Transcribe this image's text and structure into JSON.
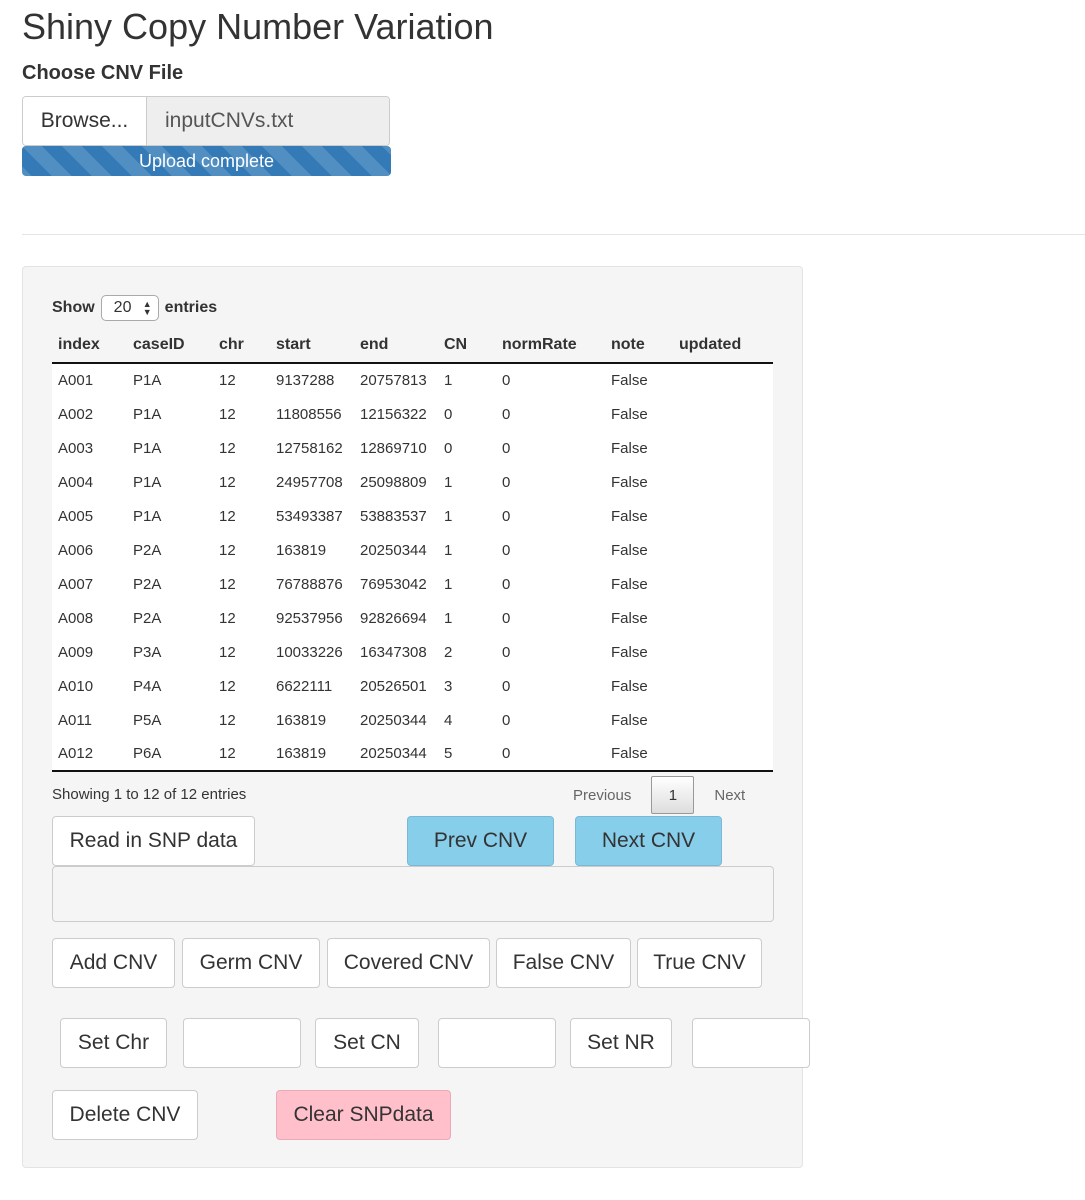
{
  "app": {
    "title": "Shiny Copy Number Variation"
  },
  "file_upload": {
    "label": "Choose CNV File",
    "browse_label": "Browse...",
    "file_name": "inputCNVs.txt",
    "progress_text": "Upload complete",
    "progress_fraction": 1.0,
    "progress_color": "#337ab7"
  },
  "table": {
    "show_label": "Show",
    "page_length": "20",
    "entries_label": "entries",
    "columns": [
      "index",
      "caseID",
      "chr",
      "start",
      "end",
      "CN",
      "normRate",
      "note",
      "updated"
    ],
    "rows": [
      [
        "A001",
        "P1A",
        "12",
        "9137288",
        "20757813",
        "1",
        "0",
        "False",
        ""
      ],
      [
        "A002",
        "P1A",
        "12",
        "11808556",
        "12156322",
        "0",
        "0",
        "False",
        ""
      ],
      [
        "A003",
        "P1A",
        "12",
        "12758162",
        "12869710",
        "0",
        "0",
        "False",
        ""
      ],
      [
        "A004",
        "P1A",
        "12",
        "24957708",
        "25098809",
        "1",
        "0",
        "False",
        ""
      ],
      [
        "A005",
        "P1A",
        "12",
        "53493387",
        "53883537",
        "1",
        "0",
        "False",
        ""
      ],
      [
        "A006",
        "P2A",
        "12",
        "163819",
        "20250344",
        "1",
        "0",
        "False",
        ""
      ],
      [
        "A007",
        "P2A",
        "12",
        "76788876",
        "76953042",
        "1",
        "0",
        "False",
        ""
      ],
      [
        "A008",
        "P2A",
        "12",
        "92537956",
        "92826694",
        "1",
        "0",
        "False",
        ""
      ],
      [
        "A009",
        "P3A",
        "12",
        "10033226",
        "16347308",
        "2",
        "0",
        "False",
        ""
      ],
      [
        "A010",
        "P4A",
        "12",
        "6622111",
        "20526501",
        "3",
        "0",
        "False",
        ""
      ],
      [
        "A011",
        "P5A",
        "12",
        "163819",
        "20250344",
        "4",
        "0",
        "False",
        ""
      ],
      [
        "A012",
        "P6A",
        "12",
        "163819",
        "20250344",
        "5",
        "0",
        "False",
        ""
      ]
    ],
    "info": "Showing 1 to 12 of 12 entries",
    "pager": {
      "previous": "Previous",
      "page": "1",
      "next": "Next"
    }
  },
  "buttons": {
    "read_snp": "Read in SNP data",
    "prev_cnv": "Prev CNV",
    "next_cnv": "Next CNV",
    "add_cnv": "Add CNV",
    "germ_cnv": "Germ CNV",
    "covered_cnv": "Covered CNV",
    "false_cnv": "False CNV",
    "true_cnv": "True CNV",
    "set_chr": "Set Chr",
    "set_cn": "Set CN",
    "set_nr": "Set NR",
    "delete_cnv": "Delete CNV",
    "clear_snpdata": "Clear SNPdata"
  },
  "inputs": {
    "chr_value": "",
    "cn_value": "",
    "nr_value": ""
  },
  "colors": {
    "nav_button": "#87ceeb",
    "clear_button": "#ffc0cb"
  }
}
